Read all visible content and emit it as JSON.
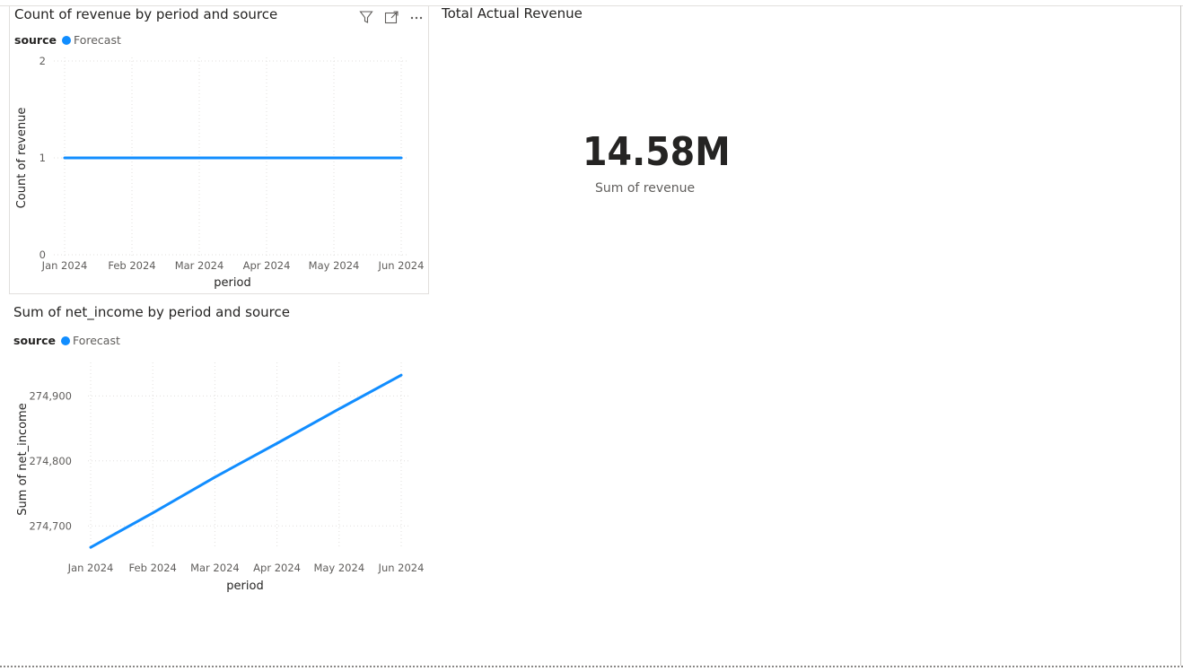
{
  "visuals": {
    "revenue_count_chart": {
      "title": "Count of revenue by period and source",
      "legend": {
        "title": "source",
        "items": [
          {
            "name": "Forecast",
            "color": "#118DFF"
          }
        ]
      },
      "icons": [
        "filter-icon",
        "focus-mode-icon",
        "more-options-icon"
      ]
    },
    "total_actual_revenue_card": {
      "title": "Total Actual Revenue",
      "value": "14.58M",
      "label": "Sum of revenue"
    },
    "net_income_chart": {
      "title": "Sum of net_income by period and source",
      "legend": {
        "title": "source",
        "items": [
          {
            "name": "Forecast",
            "color": "#118DFF"
          }
        ]
      }
    }
  },
  "chart_data": [
    {
      "type": "line",
      "title": "Count of revenue by period and source",
      "xlabel": "period",
      "ylabel": "Count of revenue",
      "categories": [
        "Jan 2024",
        "Feb 2024",
        "Mar 2024",
        "Apr 2024",
        "May 2024",
        "Jun 2024"
      ],
      "yticks": [
        "0",
        "1",
        "2"
      ],
      "ylim": [
        0,
        2
      ],
      "grid": true,
      "legend_position": "top-left",
      "series": [
        {
          "name": "Forecast",
          "color": "#118DFF",
          "values": [
            1,
            1,
            1,
            1,
            1,
            1
          ]
        }
      ]
    },
    {
      "type": "line",
      "title": "Sum of net_income by period and source",
      "xlabel": "period",
      "ylabel": "Sum of net_income",
      "categories": [
        "Jan 2024",
        "Feb 2024",
        "Mar 2024",
        "Apr 2024",
        "May 2024",
        "Jun 2024"
      ],
      "yticks": [
        "274,700",
        "274,800",
        "274,900"
      ],
      "ytick_values": [
        274700,
        274800,
        274900
      ],
      "ylim": [
        274670,
        274935
      ],
      "grid": true,
      "legend_position": "top-left",
      "series": [
        {
          "name": "Forecast",
          "color": "#118DFF",
          "values": [
            274667,
            274720,
            274775,
            274827,
            274880,
            274932
          ]
        }
      ]
    }
  ]
}
